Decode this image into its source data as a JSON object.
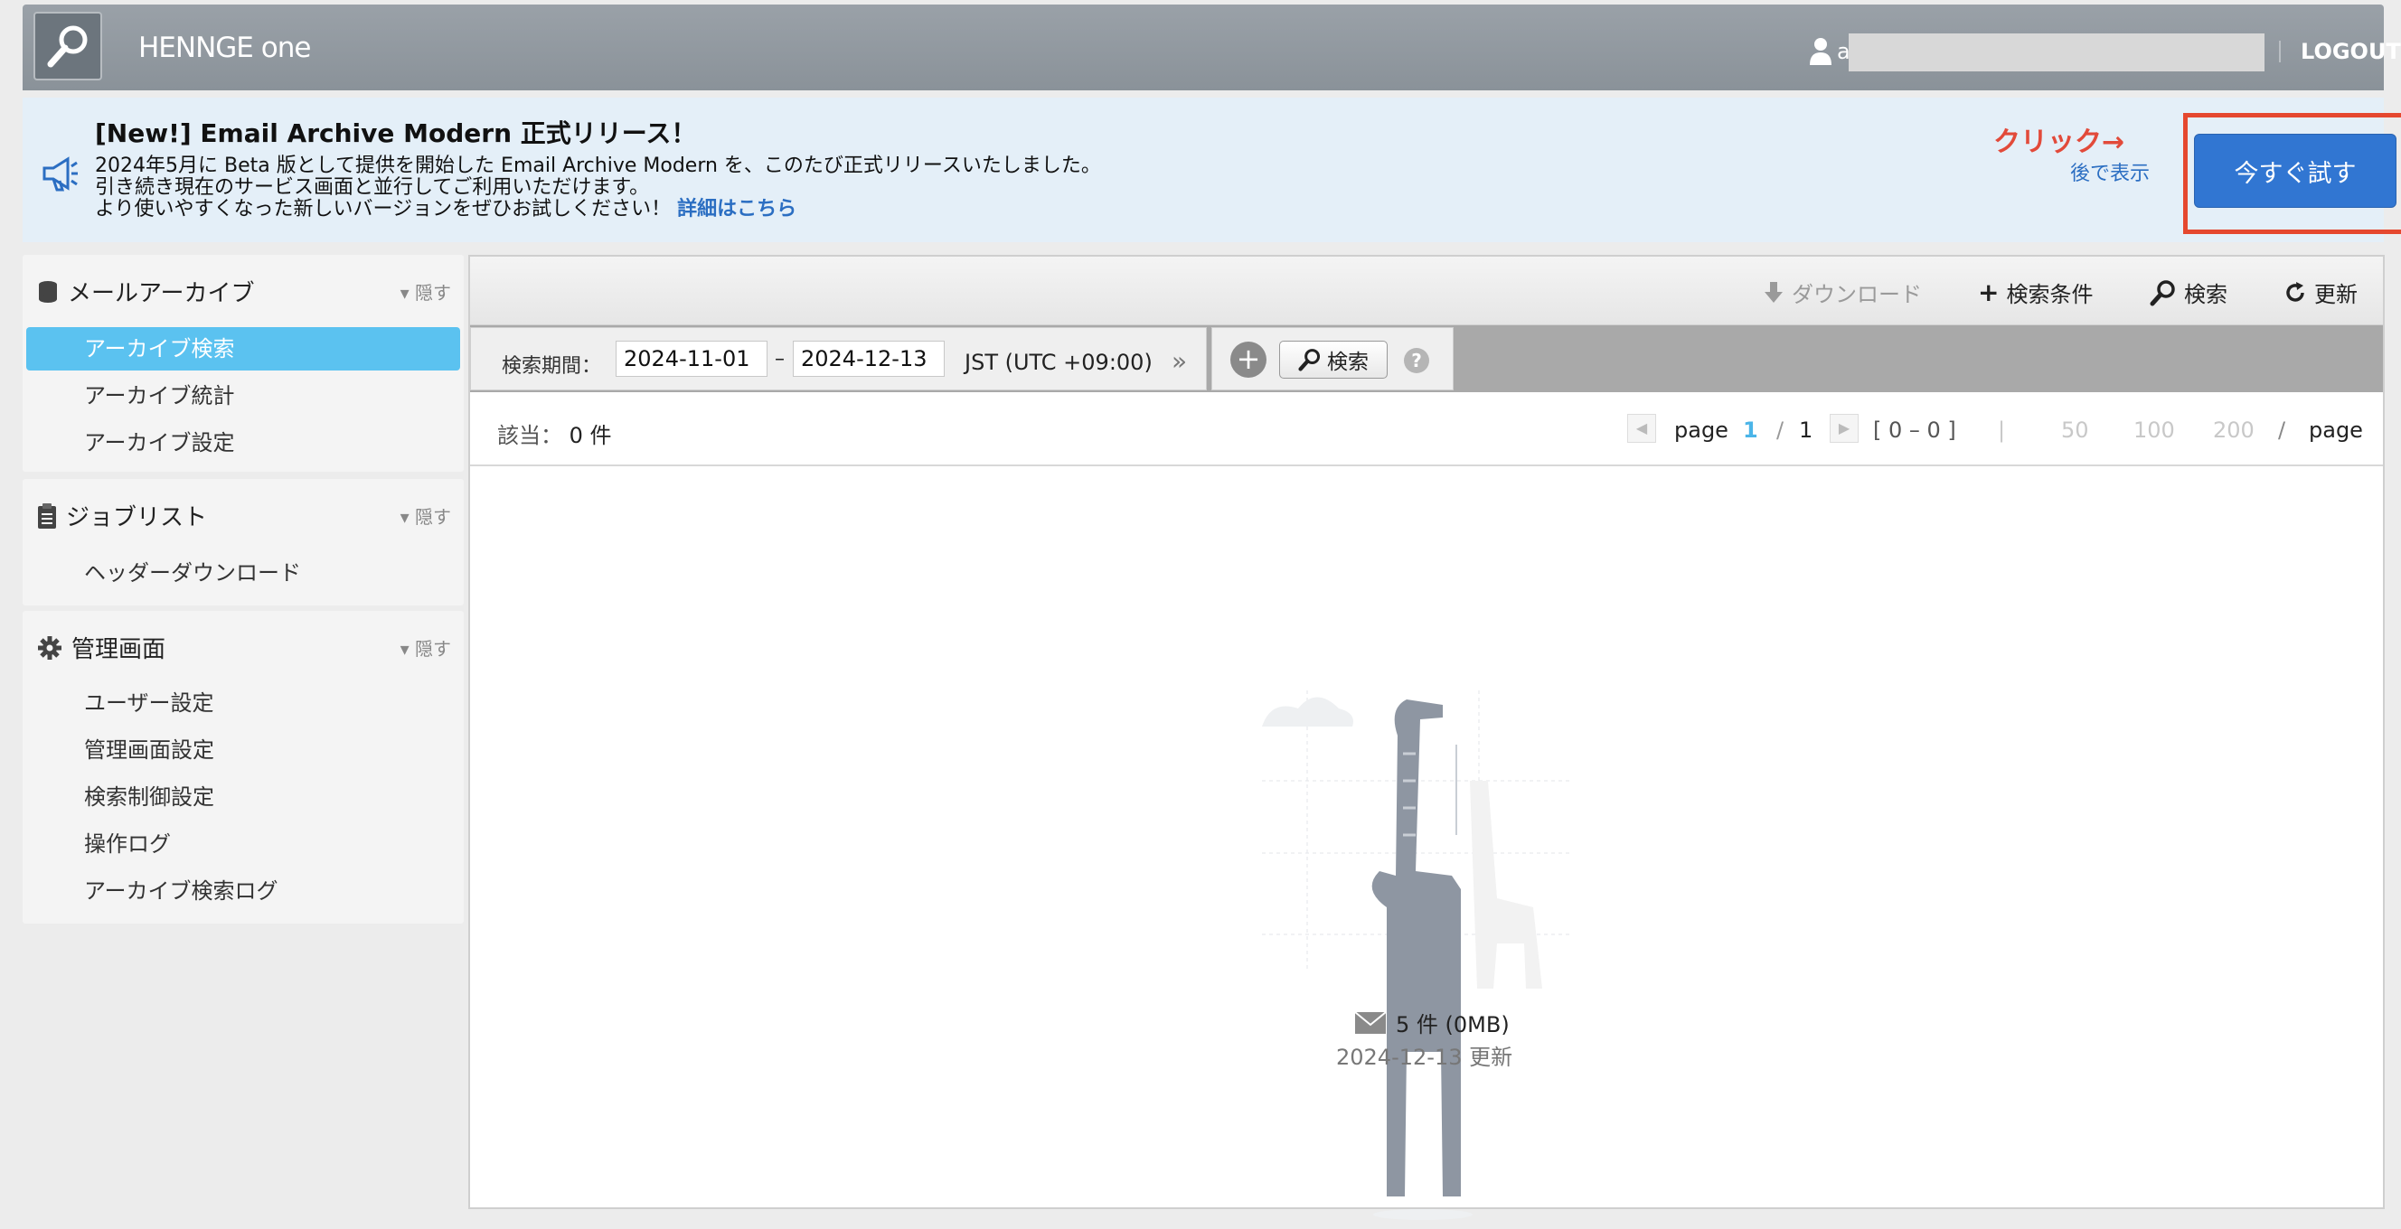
{
  "header": {
    "brand": "HENNGE one",
    "user_initial": "a",
    "logout_label": "LOGOUT"
  },
  "announcement": {
    "title": "[New!] Email Archive Modern 正式リリース！",
    "line1": "2024年5月に Beta 版として提供を開始した Email Archive Modern を、このたび正式リリースいたしました。",
    "line2": "引き続き現在のサービス画面と並行してご利用いただけます。",
    "line3": "より使いやすくなった新しいバージョンをぜひお試しください！",
    "details_link": "詳細はこちら",
    "click_hint": "クリック→",
    "later_label": "後で表示",
    "try_now_label": "今すぐ試す"
  },
  "sidebar": {
    "sections": [
      {
        "title": "メールアーカイブ",
        "hide_label": "隠す",
        "items": [
          "アーカイブ検索",
          "アーカイブ統計",
          "アーカイブ設定"
        ]
      },
      {
        "title": "ジョブリスト",
        "hide_label": "隠す",
        "items": [
          "ヘッダーダウンロード"
        ]
      },
      {
        "title": "管理画面",
        "hide_label": "隠す",
        "items": [
          "ユーザー設定",
          "管理画面設定",
          "検索制御設定",
          "操作ログ",
          "アーカイブ検索ログ"
        ]
      }
    ],
    "active_item": "アーカイブ検索"
  },
  "toolbar": {
    "download_label": "ダウンロード",
    "search_conditions_label": "検索条件",
    "search_label": "検索",
    "refresh_label": "更新"
  },
  "search": {
    "period_label": "検索期間：",
    "date_from": "2024-11-01",
    "date_sep": "–",
    "date_to": "2024-12-13",
    "timezone": "JST (UTC +09:00)",
    "search_button_label": "検索"
  },
  "results": {
    "count_label": "該当：",
    "count_value": "0 件",
    "page_word": "page",
    "current_page": "1",
    "page_sep": "/",
    "total_pages": "1",
    "range": "[ 0 – 0 ]",
    "per_page_sep": "|",
    "per_page_options": [
      "50",
      "100",
      "200"
    ],
    "per_page_slash": "/",
    "per_page_word": "page"
  },
  "empty_state": {
    "mail_count": "5 件 (0MB)",
    "updated": "2024-12-13 更新"
  }
}
